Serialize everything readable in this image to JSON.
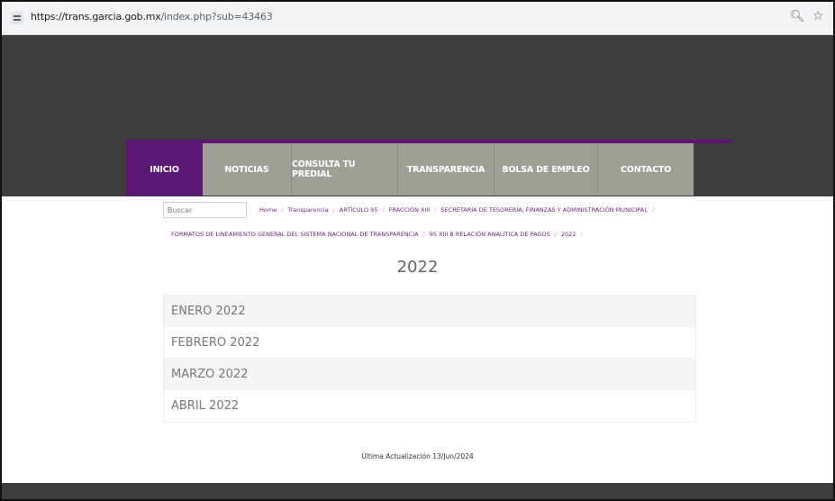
{
  "browser": {
    "url_host": "https://trans.garcia.gob.mx",
    "url_path": "/index.php?sub=43463",
    "zoom_icon": "zoom-icon",
    "bookmark_icon": "star-icon"
  },
  "colors": {
    "brand_purple": "#5b1573",
    "nav_gray": "#9f9f98",
    "header_dark": "#3d3d3d"
  },
  "nav": [
    {
      "label": "INICIO",
      "active": true
    },
    {
      "label": "NOTICIAS"
    },
    {
      "label": "CONSULTA TU PREDIAL"
    },
    {
      "label": "TRANSPARENCIA"
    },
    {
      "label": "BOLSA DE EMPLEO"
    },
    {
      "label": "CONTACTO"
    }
  ],
  "search": {
    "placeholder": "Buscar"
  },
  "breadcrumb": [
    "Home",
    "Transparencia",
    "ARTÍCULO 95",
    "FRACCIÓN XIII",
    "SECRETARÍA DE TESORERÍA, FINANZAS Y ADMINISTRACIÓN MUNICIPAL",
    "FORMATOS DE LINEAMIENTO GENERAL DEL SISTEMA NACIONAL DE TRANSPARENCIA",
    "95 XIII B RELACIÓN ANALÍTICA DE PAGOS",
    "2022"
  ],
  "page_title": "2022",
  "months": [
    "ENERO 2022",
    "FEBRERO 2022",
    "MARZO 2022",
    "ABRIL 2022"
  ],
  "last_update": "Última Actualización 13/Jun/2024"
}
